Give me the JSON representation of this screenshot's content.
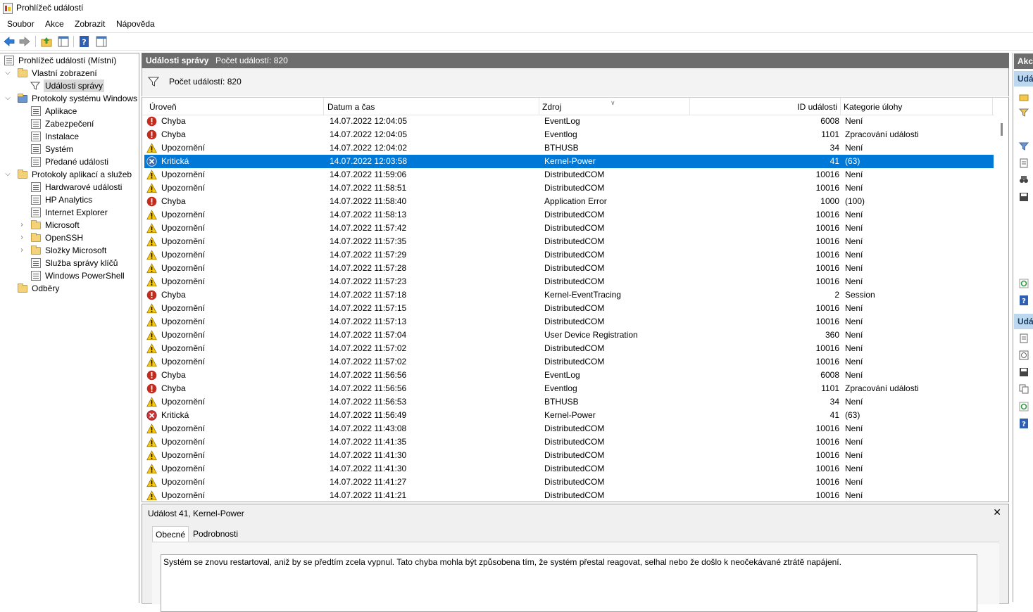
{
  "window": {
    "title": "Prohlížeč událostí"
  },
  "menu": [
    "Soubor",
    "Akce",
    "Zobrazit",
    "Nápověda"
  ],
  "tree": {
    "items": [
      {
        "label": "Prohlížeč událostí (Místní)"
      },
      {
        "label": "Vlastní zobrazení"
      },
      {
        "label": "Události správy"
      },
      {
        "label": "Protokoly systému Windows"
      },
      {
        "label": "Aplikace"
      },
      {
        "label": "Zabezpečení"
      },
      {
        "label": "Instalace"
      },
      {
        "label": "Systém"
      },
      {
        "label": "Předané události"
      },
      {
        "label": "Protokoly aplikací a služeb"
      },
      {
        "label": "Hardwarové události"
      },
      {
        "label": "HP Analytics"
      },
      {
        "label": "Internet Explorer"
      },
      {
        "label": "Microsoft"
      },
      {
        "label": "OpenSSH"
      },
      {
        "label": "Složky Microsoft"
      },
      {
        "label": "Služba správy klíčů"
      },
      {
        "label": "Windows PowerShell"
      },
      {
        "label": "Odběry"
      }
    ]
  },
  "panel": {
    "title": "Události správy",
    "count": "Počet událostí: 820",
    "filter_text": "Počet událostí: 820"
  },
  "columns": [
    "Úroveň",
    "Datum a čas",
    "Zdroj",
    "ID události",
    "Kategorie úlohy"
  ],
  "rows": [
    [
      "Chyba",
      "14.07.2022 12:04:05",
      "EventLog",
      "6008",
      "Není"
    ],
    [
      "Chyba",
      "14.07.2022 12:04:05",
      "Eventlog",
      "1101",
      "Zpracování události"
    ],
    [
      "Upozornění",
      "14.07.2022 12:04:02",
      "BTHUSB",
      "34",
      "Není"
    ],
    [
      "Kritická",
      "14.07.2022 12:03:58",
      "Kernel-Power",
      "41",
      "(63)"
    ],
    [
      "Upozornění",
      "14.07.2022 11:59:06",
      "DistributedCOM",
      "10016",
      "Není"
    ],
    [
      "Upozornění",
      "14.07.2022 11:58:51",
      "DistributedCOM",
      "10016",
      "Není"
    ],
    [
      "Chyba",
      "14.07.2022 11:58:40",
      "Application Error",
      "1000",
      "(100)"
    ],
    [
      "Upozornění",
      "14.07.2022 11:58:13",
      "DistributedCOM",
      "10016",
      "Není"
    ],
    [
      "Upozornění",
      "14.07.2022 11:57:42",
      "DistributedCOM",
      "10016",
      "Není"
    ],
    [
      "Upozornění",
      "14.07.2022 11:57:35",
      "DistributedCOM",
      "10016",
      "Není"
    ],
    [
      "Upozornění",
      "14.07.2022 11:57:29",
      "DistributedCOM",
      "10016",
      "Není"
    ],
    [
      "Upozornění",
      "14.07.2022 11:57:28",
      "DistributedCOM",
      "10016",
      "Není"
    ],
    [
      "Upozornění",
      "14.07.2022 11:57:23",
      "DistributedCOM",
      "10016",
      "Není"
    ],
    [
      "Chyba",
      "14.07.2022 11:57:18",
      "Kernel-EventTracing",
      "2",
      "Session"
    ],
    [
      "Upozornění",
      "14.07.2022 11:57:15",
      "DistributedCOM",
      "10016",
      "Není"
    ],
    [
      "Upozornění",
      "14.07.2022 11:57:13",
      "DistributedCOM",
      "10016",
      "Není"
    ],
    [
      "Upozornění",
      "14.07.2022 11:57:04",
      "User Device Registration",
      "360",
      "Není"
    ],
    [
      "Upozornění",
      "14.07.2022 11:57:02",
      "DistributedCOM",
      "10016",
      "Není"
    ],
    [
      "Upozornění",
      "14.07.2022 11:57:02",
      "DistributedCOM",
      "10016",
      "Není"
    ],
    [
      "Chyba",
      "14.07.2022 11:56:56",
      "EventLog",
      "6008",
      "Není"
    ],
    [
      "Chyba",
      "14.07.2022 11:56:56",
      "Eventlog",
      "1101",
      "Zpracování události"
    ],
    [
      "Upozornění",
      "14.07.2022 11:56:53",
      "BTHUSB",
      "34",
      "Není"
    ],
    [
      "Kritická",
      "14.07.2022 11:56:49",
      "Kernel-Power",
      "41",
      "(63)"
    ],
    [
      "Upozornění",
      "14.07.2022 11:43:08",
      "DistributedCOM",
      "10016",
      "Není"
    ],
    [
      "Upozornění",
      "14.07.2022 11:41:35",
      "DistributedCOM",
      "10016",
      "Není"
    ],
    [
      "Upozornění",
      "14.07.2022 11:41:30",
      "DistributedCOM",
      "10016",
      "Není"
    ],
    [
      "Upozornění",
      "14.07.2022 11:41:30",
      "DistributedCOM",
      "10016",
      "Není"
    ],
    [
      "Upozornění",
      "14.07.2022 11:41:27",
      "DistributedCOM",
      "10016",
      "Není"
    ],
    [
      "Upozornění",
      "14.07.2022 11:41:21",
      "DistributedCOM",
      "10016",
      "Není"
    ]
  ],
  "selected_row": 3,
  "detail": {
    "title": "Událost 41, Kernel-Power",
    "tabs": [
      "Obecné",
      "Podrobnosti"
    ],
    "message": "Systém se znovu restartoval, aniž by se předtím zcela vypnul. Tato chyba mohla být způsobena tím, že systém přestal reagovat, selhal nebo že došlo k neočekávané ztrátě napájení."
  },
  "actions": {
    "header_top": "Akce",
    "section1": "Udá",
    "section2": "Udá"
  },
  "colors": {
    "selection": "#0078d7",
    "header_bg": "#6d6d6d",
    "error": "#c42b1c",
    "warning": "#f7c80d",
    "critical": "#d13438"
  },
  "icons": {
    "error": "error-icon",
    "warning": "warning-icon",
    "critical": "critical-icon"
  }
}
